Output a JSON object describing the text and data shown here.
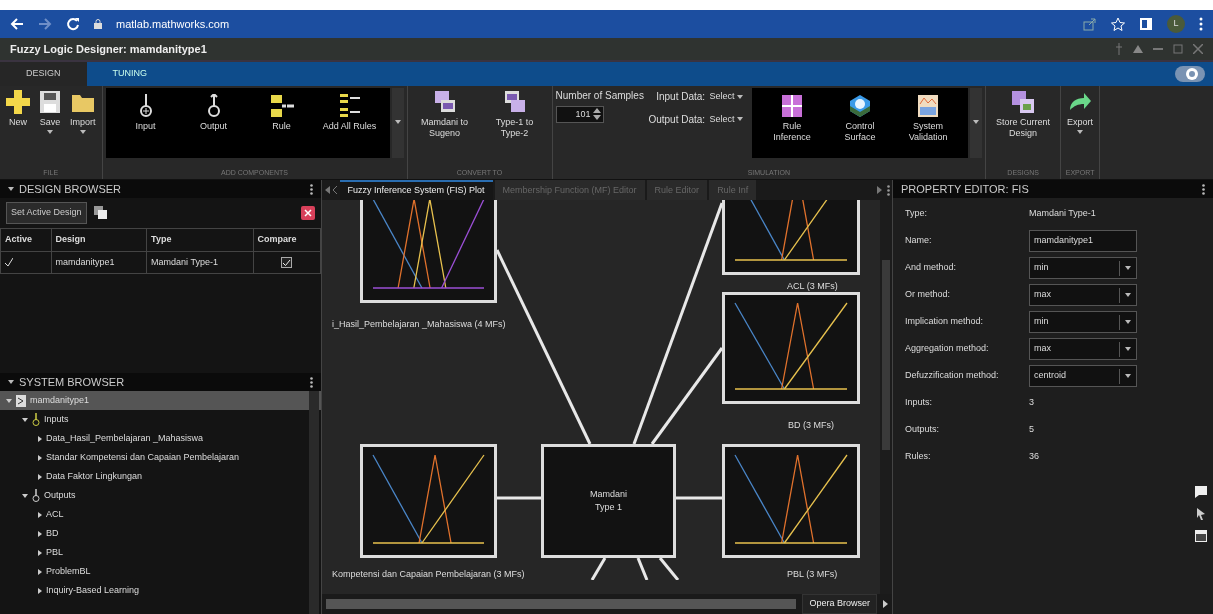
{
  "browser": {
    "url": "matlab.mathworks.com",
    "profile": "L"
  },
  "app": {
    "title": "Fuzzy Logic Designer: mamdanitype1"
  },
  "ribbon_tabs": [
    {
      "label": "DESIGN",
      "selected": true
    },
    {
      "label": "TUNING",
      "selected": false
    }
  ],
  "toolstrip": [
    {
      "label": "FILE",
      "kind": "plain",
      "buttons": [
        {
          "label": "New",
          "menu": false
        },
        {
          "label": "Save",
          "menu": true
        },
        {
          "label": "Import",
          "menu": true
        }
      ]
    },
    {
      "label": "ADD COMPONENTS",
      "kind": "gallery",
      "buttons": [
        {
          "label": "Input",
          "menu": false
        },
        {
          "label": "Output",
          "menu": false
        },
        {
          "label": "Rule",
          "menu": false
        },
        {
          "label": "Add All Rules",
          "menu": false
        }
      ]
    },
    {
      "label": "CONVERT TO",
      "kind": "plain",
      "buttons": [
        {
          "label": "Mamdani to Sugeno",
          "menu": false
        },
        {
          "label": "Type-1 to Type-2",
          "menu": false
        }
      ]
    },
    {
      "label": "SIMULATION",
      "kind": "simulation",
      "fields": [
        {
          "label": "Number of Samples",
          "value": "101"
        },
        {
          "label": "Input Data:",
          "value": "Select"
        },
        {
          "label": "Output Data:",
          "value": "Select"
        }
      ],
      "buttons": [
        {
          "label": "Rule Inference",
          "menu": false
        },
        {
          "label": "Control Surface",
          "menu": false
        },
        {
          "label": "System Validation",
          "menu": false
        }
      ]
    },
    {
      "label": "DESIGNS",
      "kind": "plain",
      "buttons": [
        {
          "label": "Store Current Design",
          "menu": false
        }
      ]
    },
    {
      "label": "EXPORT",
      "kind": "plain",
      "buttons": [
        {
          "label": "Export",
          "menu": true
        }
      ]
    }
  ],
  "design_browser": {
    "title": "DESIGN BROWSER",
    "set_active": "Set Active Design",
    "columns": [
      "Active",
      "Design",
      "Type",
      "Compare"
    ],
    "rows": [
      {
        "active": true,
        "design": "mamdanitype1",
        "type": "Mamdani Type-1",
        "compare": true
      }
    ]
  },
  "system_browser": {
    "title": "SYSTEM BROWSER",
    "tree": [
      {
        "label": "mamdanitype1",
        "kind": "system",
        "expanded": true,
        "selected": true,
        "children": [
          {
            "label": "Inputs",
            "kind": "inputs",
            "expanded": true,
            "selected": false,
            "children": [
              {
                "label": "Data_Hasil_Pembelajaran _Mahasiswa",
                "expanded": false,
                "selected": false
              },
              {
                "label": "Standar Kompetensi dan Capaian Pembelajaran",
                "expanded": false,
                "selected": false
              },
              {
                "label": "Data Faktor Lingkungan",
                "expanded": false,
                "selected": false
              }
            ]
          },
          {
            "label": "Outputs",
            "kind": "outputs",
            "expanded": true,
            "selected": false,
            "children": [
              {
                "label": "ACL",
                "expanded": false,
                "selected": false
              },
              {
                "label": "BD",
                "expanded": false,
                "selected": false
              },
              {
                "label": "PBL",
                "expanded": false,
                "selected": false
              },
              {
                "label": "ProblemBL",
                "expanded": false,
                "selected": false
              },
              {
                "label": "Inquiry-Based Learning",
                "expanded": false,
                "selected": false
              }
            ]
          }
        ]
      }
    ]
  },
  "doc_tabs": [
    {
      "label": "Fuzzy Inference System (FIS) Plot",
      "selected": true
    },
    {
      "label": "Membership Function (MF) Editor",
      "selected": false
    },
    {
      "label": "Rule Editor",
      "selected": false
    },
    {
      "label": "Rule Inf",
      "selected": false
    }
  ],
  "diagram": {
    "system": "Mamdani Type 1",
    "variables": [
      {
        "label": "i_Hasil_Pembelajaran _Mahasiswa (4 MFs)",
        "mfs": [
          {
            "color": "#4a86c8"
          },
          {
            "color": "#e0712c"
          },
          {
            "color": "#e8c24e"
          },
          {
            "color": "#9b4fd6"
          }
        ]
      },
      {
        "label": "Kompetensi dan Capaian Pembelajaran (3 MFs)",
        "mfs": [
          {
            "color": "#4a86c8"
          },
          {
            "color": "#e0712c"
          },
          {
            "color": "#e8c24e"
          }
        ]
      },
      {
        "label": "ACL (3 MFs)",
        "mfs": [
          {
            "color": "#4a86c8"
          },
          {
            "color": "#e0712c"
          },
          {
            "color": "#e8c24e"
          }
        ]
      },
      {
        "label": "BD (3 MFs)",
        "mfs": [
          {
            "color": "#4a86c8"
          },
          {
            "color": "#e0712c"
          },
          {
            "color": "#e8c24e"
          }
        ]
      },
      {
        "label": "PBL (3 MFs)",
        "mfs": [
          {
            "color": "#4a86c8"
          },
          {
            "color": "#e0712c"
          },
          {
            "color": "#e8c24e"
          }
        ]
      }
    ],
    "popup": "Opera Browser"
  },
  "property_editor": {
    "title": "PROPERTY EDITOR: FIS",
    "rows": [
      {
        "label": "Type:",
        "value": "Mamdani Type-1",
        "kind": "text"
      },
      {
        "label": "Name:",
        "value": "mamdanitype1",
        "kind": "input"
      },
      {
        "label": "And method:",
        "value": "min",
        "kind": "select"
      },
      {
        "label": "Or method:",
        "value": "max",
        "kind": "select"
      },
      {
        "label": "Implication method:",
        "value": "min",
        "kind": "select"
      },
      {
        "label": "Aggregation method:",
        "value": "max",
        "kind": "select"
      },
      {
        "label": "Defuzzification method:",
        "value": "centroid",
        "kind": "select"
      },
      {
        "label": "Inputs:",
        "value": "3",
        "kind": "text"
      },
      {
        "label": "Outputs:",
        "value": "5",
        "kind": "text"
      },
      {
        "label": "Rules:",
        "value": "36",
        "kind": "text"
      }
    ]
  }
}
